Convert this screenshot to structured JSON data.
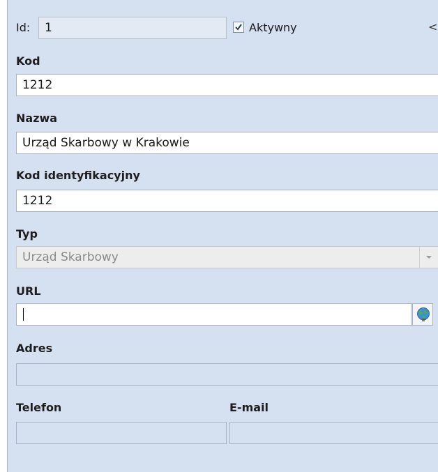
{
  "form": {
    "id_label": "Id:",
    "id_value": "1",
    "active_label": "Aktywny",
    "active_checked": true,
    "collapse_glyph": "<",
    "kod_label": "Kod",
    "kod_value": "1212",
    "nazwa_label": "Nazwa",
    "nazwa_value": "Urząd Skarbowy w Krakowie",
    "kod_ident_label": "Kod identyfikacyjny",
    "kod_ident_value": "1212",
    "typ_label": "Typ",
    "typ_value": "Urząd Skarbowy",
    "url_label": "URL",
    "url_value": "",
    "adres_label": "Adres",
    "adres_value": "",
    "telefon_label": "Telefon",
    "telefon_value": "",
    "email_label": "E-mail",
    "email_value": ""
  },
  "icons": {
    "checkbox": "checkmark-icon",
    "combo": "chevron-down-icon",
    "url_button": "globe-icon"
  },
  "colors": {
    "panel_bg": "#d5e0f1",
    "field_border": "#a7b3c4",
    "disabled_field_bg": "#ededed"
  }
}
